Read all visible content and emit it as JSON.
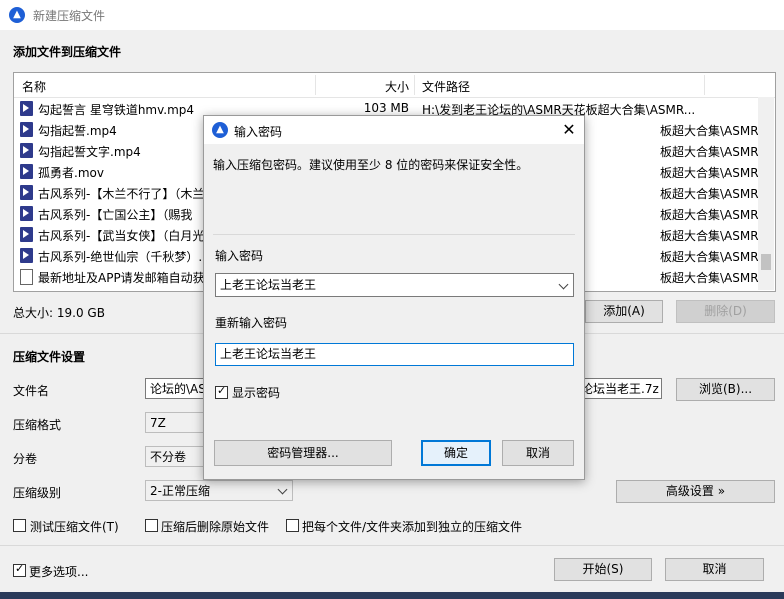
{
  "window": {
    "title": "新建压缩文件"
  },
  "dialog": {
    "title": "输入密码",
    "message": "输入压缩包密码。建议使用至少 8 位的密码来保证安全性。",
    "password_label": "输入密码",
    "password_value": "上老王论坛当老王",
    "confirm_label": "重新输入密码",
    "confirm_value": "上老王论坛当老王",
    "show_password": "显示密码",
    "manager_button": "密码管理器...",
    "ok_button": "确定",
    "cancel_button": "取消"
  },
  "add_files": {
    "section_title": "添加文件到压缩文件",
    "columns": {
      "name": "名称",
      "size": "大小",
      "path": "文件路径"
    },
    "rows": [
      {
        "name": "勾起誓言 星穹铁道hmv.mp4",
        "size": "103 MB",
        "path": "H:\\发到老王论坛的\\ASMR天花板超大合集\\ASMR..."
      },
      {
        "name": "勾指起誓.mp4",
        "size": "",
        "path": "板超大合集\\ASMR..."
      },
      {
        "name": "勾指起誓文字.mp4",
        "size": "",
        "path": "板超大合集\\ASMR..."
      },
      {
        "name": "孤勇者.mov",
        "size": "",
        "path": "板超大合集\\ASMR..."
      },
      {
        "name": "古风系列-【木兰不行了】（木兰",
        "size": "",
        "path": "板超大合集\\ASMR..."
      },
      {
        "name": "古风系列-【亡国公主】（赐我",
        "size": "",
        "path": "板超大合集\\ASMR..."
      },
      {
        "name": "古风系列-【武当女侠】（白月光",
        "size": "",
        "path": "板超大合集\\ASMR..."
      },
      {
        "name": "古风系列-绝世仙宗（千秋梦）.",
        "size": "",
        "path": "板超大合集\\ASMR..."
      },
      {
        "name": "最新地址及APP请发邮箱自动获",
        "size": "",
        "path": "板超大合集\\ASMR..."
      }
    ],
    "total_size": "总大小: 19.0 GB",
    "add_button": "添加(A)",
    "delete_button": "删除(D)"
  },
  "settings": {
    "section_title": "压缩文件设置",
    "filename_label": "文件名",
    "filename_value_left": "论坛的\\ASM",
    "filename_value_right": "论坛当老王.7z",
    "browse_button": "浏览(B)...",
    "format_label": "压缩格式",
    "format_value": "7Z",
    "split_label": "分卷",
    "split_value": "不分卷",
    "level_label": "压缩级别",
    "level_value": "2-正常压缩",
    "advanced_button": "高级设置 »",
    "test_checkbox": "测试压缩文件(T)",
    "delete_after_checkbox": "压缩后删除原始文件",
    "separate_checkbox": "把每个文件/文件夹添加到独立的压缩文件",
    "more_options": "更多选项...",
    "start_button": "开始(S)",
    "cancel_button": "取消"
  }
}
